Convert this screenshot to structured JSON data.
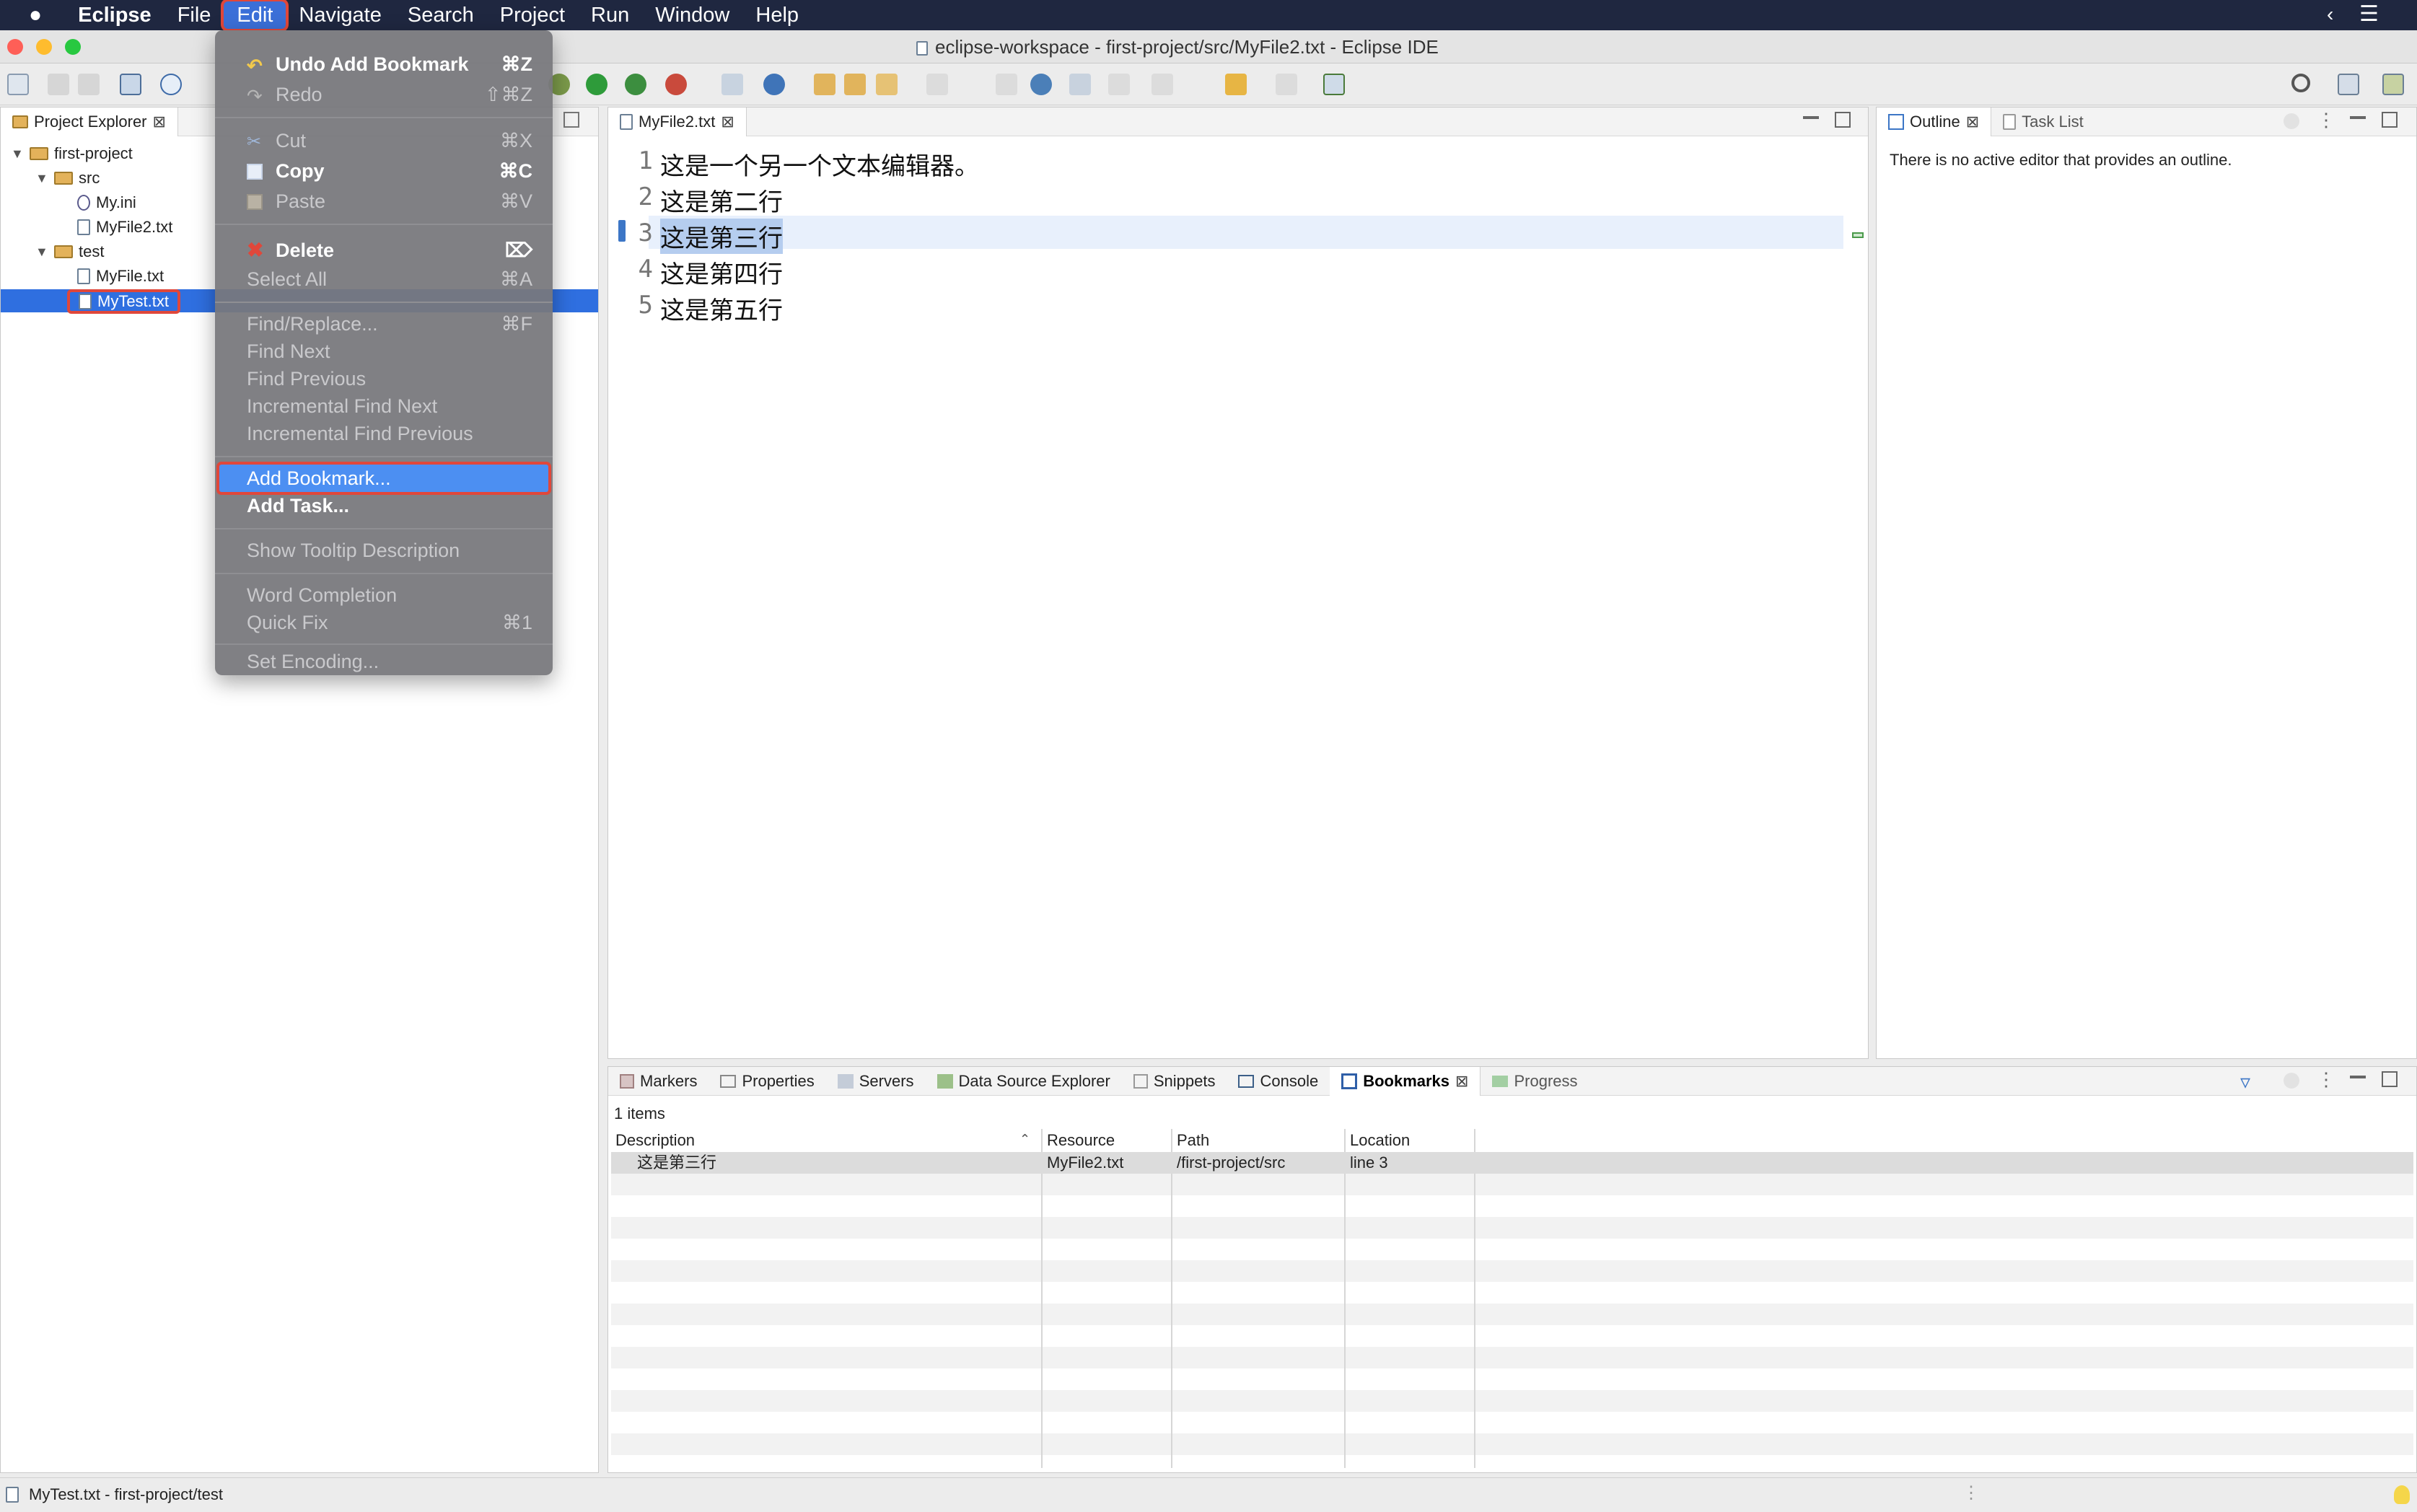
{
  "menubar": {
    "apple": "",
    "items": [
      "Eclipse",
      "File",
      "Edit",
      "Navigate",
      "Search",
      "Project",
      "Run",
      "Window",
      "Help"
    ]
  },
  "window": {
    "title": "eclipse-workspace - first-project/src/MyFile2.txt - Eclipse IDE"
  },
  "project_explorer": {
    "tab_label": "Project Explorer",
    "tree": [
      {
        "label": "first-project",
        "level": 0,
        "type": "project"
      },
      {
        "label": "src",
        "level": 1,
        "type": "folder"
      },
      {
        "label": "My.ini",
        "level": 2,
        "type": "ini"
      },
      {
        "label": "MyFile2.txt",
        "level": 2,
        "type": "file"
      },
      {
        "label": "test",
        "level": 1,
        "type": "folder"
      },
      {
        "label": "MyFile.txt",
        "level": 2,
        "type": "file"
      },
      {
        "label": "MyTest.txt",
        "level": 2,
        "type": "file",
        "selected": true
      }
    ]
  },
  "edit_menu": {
    "undo": {
      "label": "Undo Add Bookmark",
      "shortcut": "⌘Z"
    },
    "redo": {
      "label": "Redo",
      "shortcut": "⇧⌘Z"
    },
    "cut": {
      "label": "Cut",
      "shortcut": "⌘X"
    },
    "copy": {
      "label": "Copy",
      "shortcut": "⌘C"
    },
    "paste": {
      "label": "Paste",
      "shortcut": "⌘V"
    },
    "delete": {
      "label": "Delete",
      "shortcut": "⌦"
    },
    "select_all": {
      "label": "Select All",
      "shortcut": "⌘A"
    },
    "find_replace": {
      "label": "Find/Replace...",
      "shortcut": "⌘F"
    },
    "find_next": {
      "label": "Find Next"
    },
    "find_previous": {
      "label": "Find Previous"
    },
    "incremental_find_next": {
      "label": "Incremental Find Next"
    },
    "incremental_find_previous": {
      "label": "Incremental Find Previous"
    },
    "add_bookmark": {
      "label": "Add Bookmark..."
    },
    "add_task": {
      "label": "Add Task..."
    },
    "show_tooltip": {
      "label": "Show Tooltip Description"
    },
    "word_completion": {
      "label": "Word Completion"
    },
    "quick_fix": {
      "label": "Quick Fix",
      "shortcut": "⌘1"
    },
    "set_encoding": {
      "label": "Set Encoding..."
    }
  },
  "editor": {
    "tab_label": "MyFile2.txt",
    "lines": [
      {
        "num": "1",
        "text": "这是一个另一个文本编辑器。"
      },
      {
        "num": "2",
        "text": "这是第二行"
      },
      {
        "num": "3",
        "text": "这是第三行"
      },
      {
        "num": "4",
        "text": "这是第四行"
      },
      {
        "num": "5",
        "text": "这是第五行"
      }
    ]
  },
  "outline": {
    "tab_label": "Outline",
    "task_list_label": "Task List",
    "message": "There is no active editor that provides an outline."
  },
  "bottom_panel": {
    "tabs": [
      "Markers",
      "Properties",
      "Servers",
      "Data Source Explorer",
      "Snippets",
      "Console",
      "Bookmarks",
      "Progress"
    ],
    "count": "1 items",
    "columns": [
      "Description",
      "Resource",
      "Path",
      "Location"
    ],
    "rows": [
      {
        "description": "这是第三行",
        "resource": "MyFile2.txt",
        "path": "/first-project/src",
        "location": "line 3"
      }
    ]
  },
  "status_bar": {
    "text": "MyTest.txt - first-project/test"
  },
  "colors": {
    "accent": "#3b6fd8",
    "highlight_red": "#e0473a",
    "selection": "#2f6fe0",
    "menu_bg": "#78787c"
  }
}
